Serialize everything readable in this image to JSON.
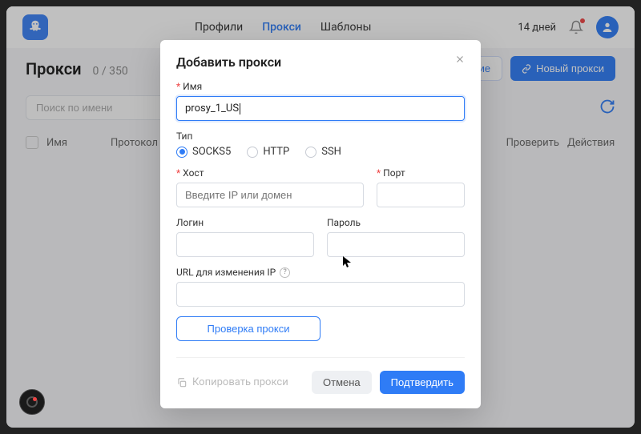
{
  "topbar": {
    "nav": {
      "profiles": "Профили",
      "proxies": "Прокси",
      "templates": "Шаблоны"
    },
    "trial": "14 дней"
  },
  "subhead": {
    "title": "Прокси",
    "count": "0 / 350",
    "actions": {
      "extension": "ление",
      "new_proxy": "Новый прокси"
    }
  },
  "toolbar": {
    "search_placeholder": "Поиск по имени"
  },
  "table": {
    "cols": {
      "name": "Имя",
      "protocol": "Протокол",
      "check": "Проверить",
      "actions": "Действия"
    }
  },
  "modal": {
    "title": "Добавить прокси",
    "name_label": "Имя",
    "name_value": "prosy_1_US",
    "type_label": "Тип",
    "types": {
      "socks5": "SOCKS5",
      "http": "HTTP",
      "ssh": "SSH"
    },
    "host_label": "Хост",
    "host_placeholder": "Введите IP или домен",
    "port_label": "Порт",
    "login_label": "Логин",
    "password_label": "Пароль",
    "url_label": "URL для изменения IP",
    "check_btn": "Проверка прокси",
    "copy_btn": "Копировать прокси",
    "cancel_btn": "Отмена",
    "confirm_btn": "Подтвердить"
  }
}
